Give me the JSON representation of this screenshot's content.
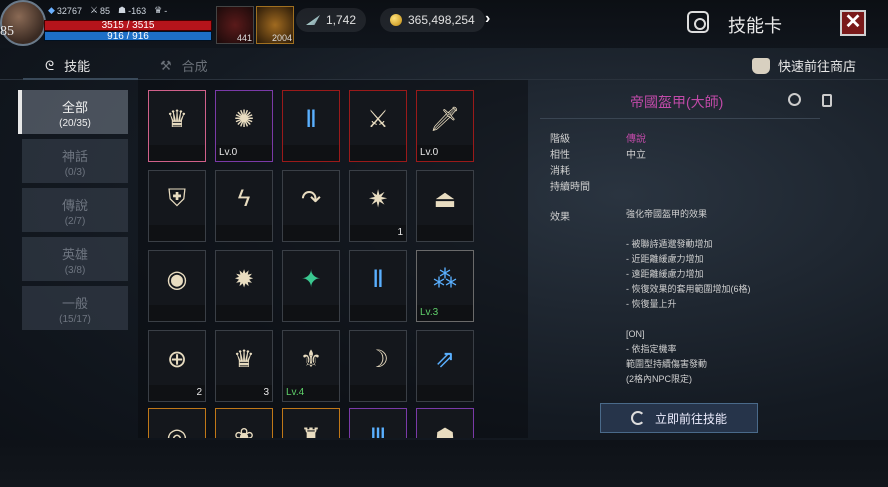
{
  "player": {
    "level": "85",
    "stat_a": "32767",
    "stat_b": "85",
    "stat_c": "-163",
    "stat_d": "-",
    "hp": "3515 / 3515",
    "mp": "916 / 916",
    "potion_count": "441",
    "item_count": "2004"
  },
  "currency": {
    "feather": "1,742",
    "gold": "365,498,254"
  },
  "window": {
    "title": "技能卡",
    "close_label": "✕"
  },
  "tabs": [
    {
      "label": "技能"
    },
    {
      "label": "合成"
    }
  ],
  "shop_link": "快速前往商店",
  "filters": [
    {
      "label": "全部",
      "count": "(20/35)"
    },
    {
      "label": "神話",
      "count": "(0/3)"
    },
    {
      "label": "傳說",
      "count": "(2/7)"
    },
    {
      "label": "英雄",
      "count": "(3/8)"
    },
    {
      "label": "一般",
      "count": "(15/17)"
    }
  ],
  "cards": [
    {
      "glyph": "♛",
      "label": "",
      "count": ""
    },
    {
      "glyph": "✺",
      "label": "Lv.0",
      "count": ""
    },
    {
      "glyph": "Ⅱ",
      "label": "",
      "count": ""
    },
    {
      "glyph": "⚔",
      "label": "",
      "count": ""
    },
    {
      "glyph": "🗡",
      "label": "Lv.0",
      "count": ""
    },
    {
      "glyph": "⛨",
      "label": "",
      "count": ""
    },
    {
      "glyph": "ϟ",
      "label": "",
      "count": ""
    },
    {
      "glyph": "↷",
      "label": "",
      "count": ""
    },
    {
      "glyph": "✷",
      "label": "",
      "count": "1"
    },
    {
      "glyph": "⏏",
      "label": "",
      "count": ""
    },
    {
      "glyph": "◉",
      "label": "",
      "count": ""
    },
    {
      "glyph": "✹",
      "label": "",
      "count": ""
    },
    {
      "glyph": "✦",
      "label": "",
      "count": ""
    },
    {
      "glyph": "Ⅱ",
      "label": "",
      "count": ""
    },
    {
      "glyph": "⁂",
      "label": "Lv.3",
      "count": ""
    },
    {
      "glyph": "⊕",
      "label": "",
      "count": "2"
    },
    {
      "glyph": "♛",
      "label": "",
      "count": "3"
    },
    {
      "glyph": "⚜",
      "label": "Lv.4",
      "count": ""
    },
    {
      "glyph": "☽",
      "label": "",
      "count": ""
    },
    {
      "glyph": "⇗",
      "label": "",
      "count": ""
    },
    {
      "glyph": "◎",
      "label": "",
      "count": ""
    },
    {
      "glyph": "❀",
      "label": "",
      "count": ""
    },
    {
      "glyph": "♜",
      "label": "",
      "count": ""
    },
    {
      "glyph": "Ⅲ",
      "label": "",
      "count": ""
    },
    {
      "glyph": "☗",
      "label": "",
      "count": ""
    }
  ],
  "detail": {
    "name": "帝國盔甲(大師)",
    "fields": [
      {
        "key": "階級",
        "value": "傳說"
      },
      {
        "key": "相性",
        "value": "中立"
      },
      {
        "key": "消耗",
        "value": ""
      },
      {
        "key": "持續時間",
        "value": ""
      }
    ],
    "effect_key": "效果",
    "effect_text": "強化帝國盔甲的效果\n\n- 被聯詩遁邈發動增加\n- 近距離緩慮力增加\n- 遠距離緩慮力增加\n- 恢復效果的套用範圍增加(6格)\n- 恢復量上升\n\n[ON]\n- 依指定機率\n範圍型持續傷害發動\n(2格內NPC限定)"
  },
  "go_button": "立即前往技能",
  "colors": {
    "legendary": "#c04aa8",
    "hp": "#b5141b",
    "mp": "#1d6fc7"
  }
}
